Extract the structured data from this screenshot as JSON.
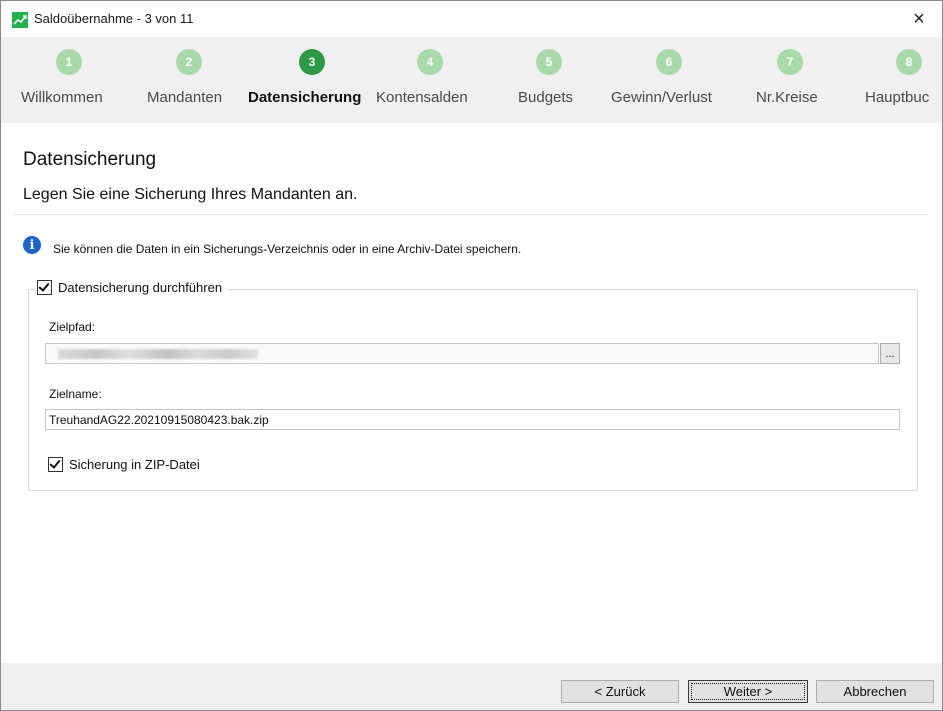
{
  "window": {
    "title": "Saldoübernahme - 3 von 11",
    "close_glyph": "×"
  },
  "steps": [
    {
      "number": "1",
      "label": "Willkommen",
      "active": false
    },
    {
      "number": "2",
      "label": "Mandanten",
      "active": false
    },
    {
      "number": "3",
      "label": "Datensicherung",
      "active": true
    },
    {
      "number": "4",
      "label": "Kontensalden",
      "active": false
    },
    {
      "number": "5",
      "label": "Budgets",
      "active": false
    },
    {
      "number": "6",
      "label": "Gewinn/Verlust",
      "active": false
    },
    {
      "number": "7",
      "label": "Nr.Kreise",
      "active": false
    },
    {
      "number": "8",
      "label": "Hauptbuc",
      "active": false
    }
  ],
  "page": {
    "title": "Datensicherung",
    "subtitle": "Legen Sie eine Sicherung Ihres Mandanten an.",
    "info_text": "Sie können die Daten in ein Sicherungs-Verzeichnis oder in eine Archiv-Datei speichern.",
    "info_icon": "info-icon"
  },
  "backup": {
    "perform_label": "Datensicherung durchführen",
    "perform_checked": true,
    "target_path_label": "Zielpfad:",
    "target_path_value": "",
    "browse_label": "...",
    "target_name_label": "Zielname:",
    "target_name_value": "TreuhandAG22.20210915080423.bak.zip",
    "zip_label": "Sicherung in ZIP-Datei",
    "zip_checked": true
  },
  "footer": {
    "back_label": "< Zurück",
    "next_label": "Weiter >",
    "cancel_label": "Abbrechen"
  },
  "colors": {
    "accent": "#2e9a46",
    "step_inactive": "#a8d9a8",
    "info_blue": "#1c64c8"
  }
}
